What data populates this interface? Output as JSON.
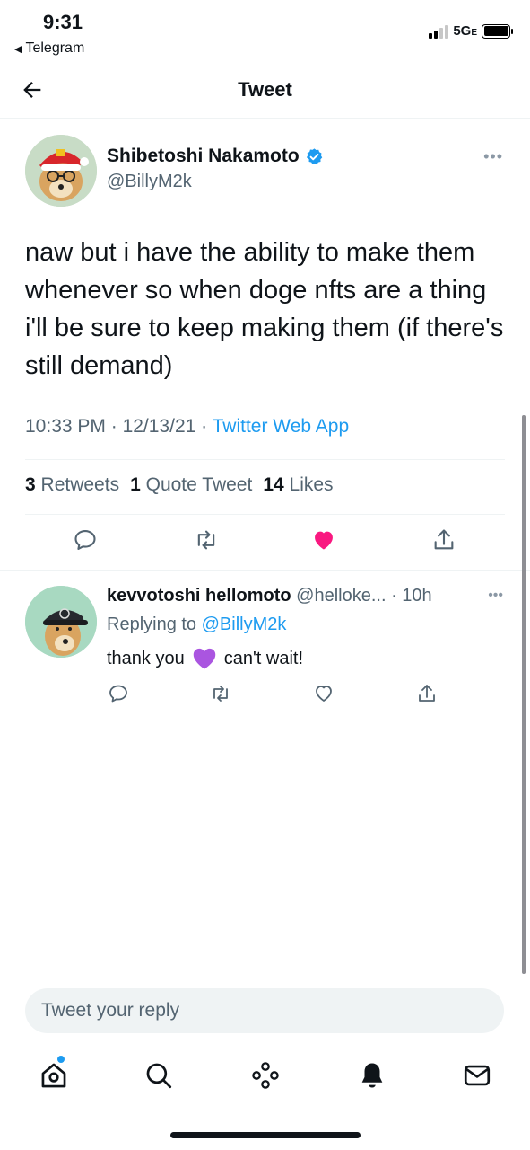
{
  "status_bar": {
    "time": "9:31",
    "back_app": "Telegram",
    "network": "5G",
    "network_suffix": "E"
  },
  "header": {
    "title": "Tweet"
  },
  "tweet": {
    "author_name": "Shibetoshi Nakamoto",
    "author_handle": "@BillyM2k",
    "text": "naw but i have the ability to make them whenever so when doge nfts are a thing i'll be sure to keep making them (if there's still demand)",
    "time": "10:33 PM",
    "date": "12/13/21",
    "source": "Twitter Web App",
    "retweets_count": "3",
    "retweets_label": "Retweets",
    "quotes_count": "1",
    "quotes_label": "Quote Tweet",
    "likes_count": "14",
    "likes_label": "Likes",
    "liked": true
  },
  "reply": {
    "author_name": "kevvotoshi hellomoto",
    "author_handle": "@helloke...",
    "time": "10h",
    "replying_to_label": "Replying to",
    "replying_to_handle": "@BillyM2k",
    "text_before": "thank you",
    "emoji": "purple-heart",
    "text_after": "can't wait!"
  },
  "composer": {
    "placeholder": "Tweet your reply"
  },
  "bottom_nav": [
    "home-icon",
    "search-icon",
    "spaces-icon",
    "notifications-icon",
    "messages-icon"
  ],
  "colors": {
    "accent": "#1d9bf0",
    "like": "#f91880",
    "text": "#0f1419",
    "muted": "#536471"
  }
}
